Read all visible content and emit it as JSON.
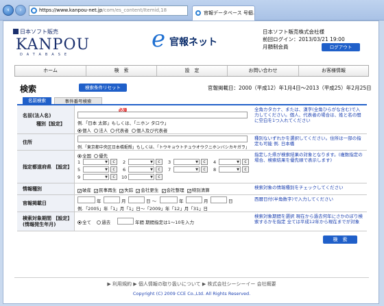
{
  "browser": {
    "url_host": "https://www.kanpou-net.jp",
    "url_path": "/com/es_content/Itemid,18",
    "tab_title": "官報データベース 号個...",
    "tab_close": "×"
  },
  "header": {
    "logo_company": "日本ソフト販売",
    "logo_name": "KANPOU",
    "logo_sub": "DATABASE",
    "brand_e": "e",
    "brand_text": "官報ネット",
    "user_company": "日本ソフト販売株式会社様",
    "last_login": "前回ログイン：2013/03/21 19:00",
    "member_type": "月額制会員",
    "logout_label": "ログアウト"
  },
  "nav": [
    "ホーム",
    "検　索",
    "設　定",
    "お問い合わせ",
    "お客様情報"
  ],
  "search": {
    "title": "検索",
    "reset_label": "検索条件リセット",
    "period": "官報掲載日：2000（平成12）年1月4日〜2013（平成25）年2月25日",
    "tabs": [
      "名前検索",
      "事件番号検索"
    ]
  },
  "form": {
    "name": {
      "label": "名前(法人名)",
      "required": "必須",
      "example": "例.「日本 太郎」もしくは、「ニホン タロウ」",
      "type_label": "種別【設定】",
      "types": [
        "個人",
        "法人",
        "代表者",
        "個人及び代表者"
      ],
      "hint": "全角カタカナ、または、漢字(全角ひらがな含む)で入力してください。個人、代表者の場合は、姓と名の間に空白を1つ入れてください"
    },
    "address": {
      "label": "住所",
      "example": "例.「東京都中央区日本橋蛎殻」もしくは、「トウキョウトチュウオウクニホンバシカキガラ」",
      "hint": "種別ないずれかを選択してください。住所は一部の指定も可能 例. 日本橋"
    },
    "pref": {
      "label": "指定都道府県 【設定】",
      "opts": [
        "全国",
        "優先"
      ],
      "nums": [
        "1",
        "2",
        "3",
        "4",
        "5",
        "6",
        "7",
        "8",
        "9",
        "10"
      ],
      "btn": "c",
      "hint": "指定した県が検索結果の対象となります。(複数指定の場合、検索結果を優先順で表示します)"
    },
    "info": {
      "label": "情報種別",
      "opts": [
        "破産",
        "民事再生",
        "失踪",
        "会社更生",
        "会社整理",
        "特別清算"
      ],
      "hint": "検索対象の情報種別をチェックしてください"
    },
    "date": {
      "label": "官報掲載日",
      "units": [
        "年",
        "月",
        "日 〜",
        "年",
        "月",
        "日"
      ],
      "example": "例.「2005」年「1」月「1」日〜「2009」年「12」月「31」日",
      "hint": "西暦日付(半角数字)で入力してください"
    },
    "range": {
      "label": "検索対象期間 【設定】",
      "label2": "(情報発生年月)",
      "opts": [
        "全て",
        "過去"
      ],
      "unit": "年間 期間指定は1〜10を入力",
      "hint": "検索対象期間を選択 現在から過去何年にさかのぼり検索するかを指定 全ては平成12年から現在までが対象"
    },
    "submit": "検　索"
  },
  "footer": {
    "links": "▶ 利用規約 ▶ 個人情報の取り扱いについて ▶ 株式会社シーシーイー 会社概要",
    "copyright": "Copyright (C) 2009 CCE Co.,Ltd. All Rights Reserved."
  }
}
